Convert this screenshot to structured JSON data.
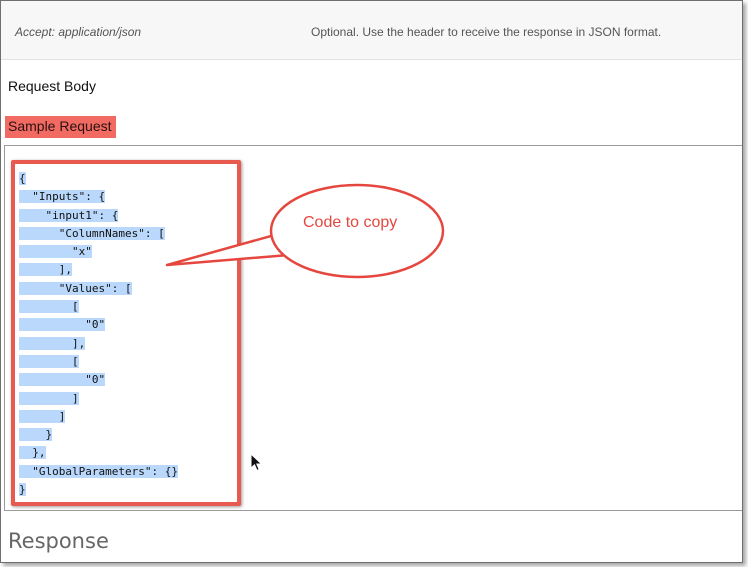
{
  "header_row": {
    "key": "Accept: application/json",
    "description": "Optional. Use the header to receive the response in JSON format."
  },
  "request_body_label": "Request Body",
  "sample_request_label": "Sample Request",
  "code_lines": [
    "{",
    "  \"Inputs\": {",
    "    \"input1\": {",
    "      \"ColumnNames\": [",
    "        \"x\"",
    "      ],",
    "      \"Values\": [",
    "        [",
    "          \"0\"",
    "        ],",
    "        [",
    "          \"0\"",
    "        ]",
    "      ]",
    "    }",
    "  },",
    "  \"GlobalParameters\": {}",
    "}"
  ],
  "callout_text": "Code to copy",
  "response_title": "Response",
  "colors": {
    "highlight_red": "#f26b63",
    "selection_blue": "#b9d8fb",
    "callout_red": "#e5473f"
  },
  "icons": {
    "cursor": "mouse-pointer-icon"
  }
}
